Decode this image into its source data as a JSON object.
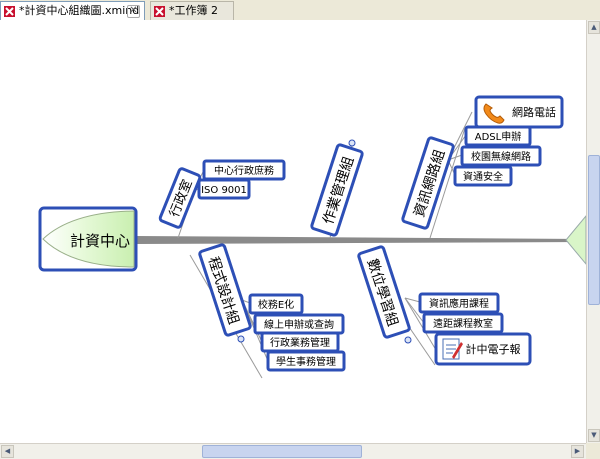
{
  "tabs": [
    {
      "label": "*計資中心組織圖.xmind",
      "active": true
    },
    {
      "label": "*工作簿 2",
      "active": false
    }
  ],
  "colors": {
    "node_border": "#2d4fb6",
    "central_fill": "#d9f5c8",
    "spine": "#808080",
    "tab_icon": "#c8102e"
  },
  "mindmap": {
    "central": "計資中心",
    "branches": [
      {
        "label": "行政室",
        "children": [
          "中心行政庶務",
          "ISO 9001"
        ]
      },
      {
        "label": "作業管理組",
        "children": []
      },
      {
        "label": "資訊網路組",
        "children": [
          "網路電話",
          "ADSL申辦",
          "校園無線網路",
          "資通安全"
        ]
      },
      {
        "label": "程式設計組",
        "children": [
          "校務E化",
          "線上申辦或查詢",
          "行政業務管理",
          "學生事務管理"
        ]
      },
      {
        "label": "數位學習組",
        "children": [
          "資訊應用課程",
          "遠距課程教室",
          "計中電子報"
        ]
      }
    ]
  },
  "icons": {
    "phone": "telephone-icon",
    "newsletter": "notepad-icon"
  }
}
